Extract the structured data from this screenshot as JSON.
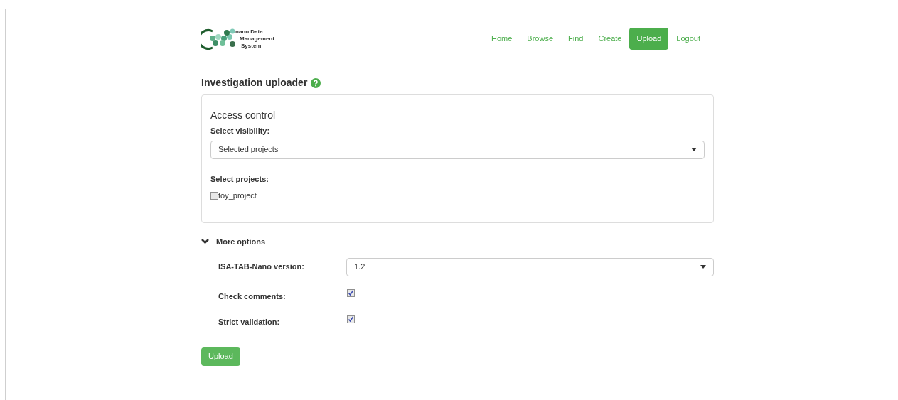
{
  "logo": {
    "lines": [
      "nano Data",
      "Management",
      "System"
    ]
  },
  "nav": [
    {
      "label": "Home",
      "selected": false
    },
    {
      "label": "Browse",
      "selected": false
    },
    {
      "label": "Find",
      "selected": false
    },
    {
      "label": "Create",
      "selected": false
    },
    {
      "label": "Upload",
      "selected": true
    },
    {
      "label": "Logout",
      "selected": false
    }
  ],
  "title": "Investigation uploader",
  "access_control": {
    "heading": "Access control",
    "visibility_label": "Select visibility:",
    "visibility_value": "Selected projects",
    "projects_label": "Select projects:",
    "projects": [
      {
        "label": "toy_project",
        "checked": false
      }
    ]
  },
  "more_options": {
    "label": "More options",
    "expanded": true,
    "fields": [
      {
        "kind": "select",
        "label": "ISA-TAB-Nano version:",
        "value": "1.2"
      },
      {
        "kind": "checkbox",
        "label": "Check comments:",
        "checked": true
      },
      {
        "kind": "checkbox",
        "label": "Strict validation:",
        "checked": true
      }
    ]
  },
  "submit": "Upload"
}
